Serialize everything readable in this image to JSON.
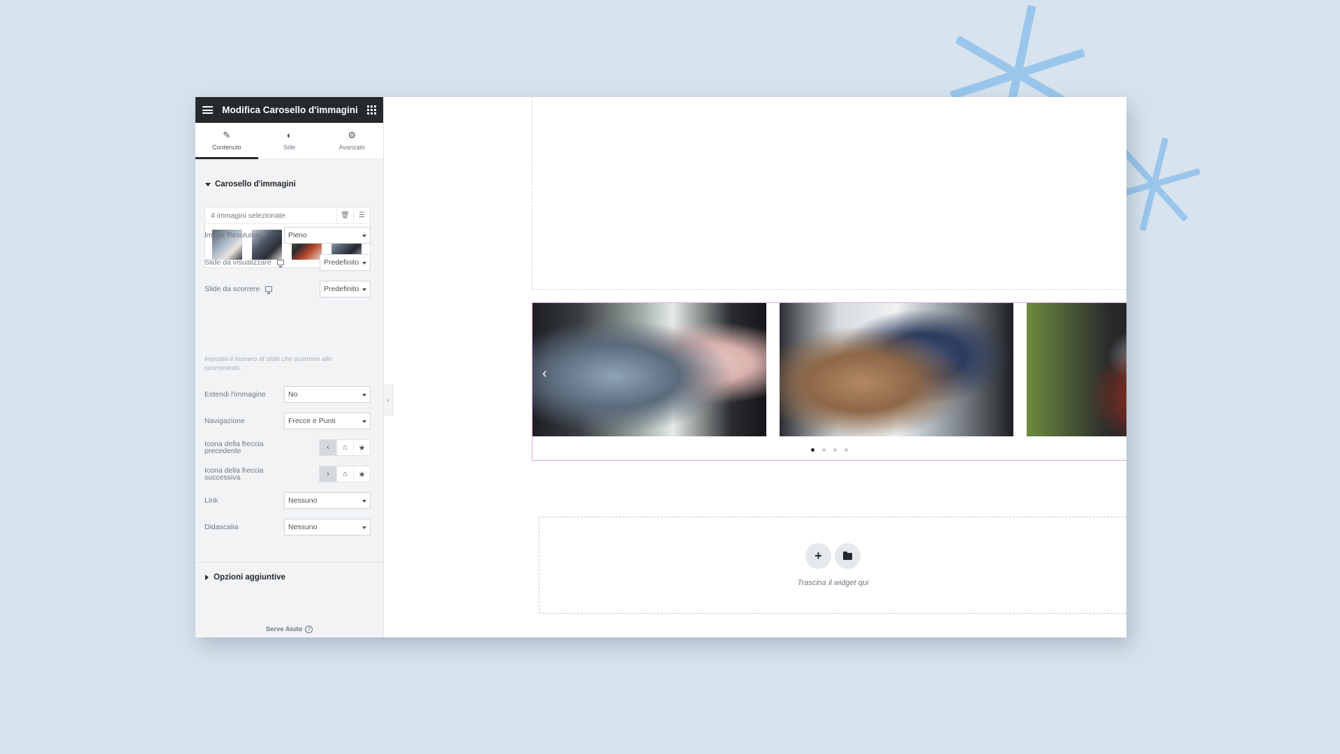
{
  "panel": {
    "title": "Modifica Carosello d'immagini",
    "tabs": [
      {
        "label": "Contenuto",
        "icon": "pencil-icon",
        "glyph": "✎"
      },
      {
        "label": "Stile",
        "icon": "half-circle-icon",
        "glyph": "◐"
      },
      {
        "label": "Avanzato",
        "icon": "gear-icon",
        "glyph": "⚙"
      }
    ],
    "section_title": "Carosello d'immagini",
    "gallery": {
      "count_label": "4 immagini selezionate",
      "delete_glyph": "🗑",
      "edit_glyph": "☰"
    },
    "controls": {
      "image_resolution": {
        "label": "Image Resolution",
        "value": "Pieno"
      },
      "slides_to_show": {
        "label": "Slide da visualizzare",
        "value": "Predefinito"
      },
      "slides_to_scroll": {
        "label": "Slide da scorrere",
        "value": "Predefinito"
      },
      "scroll_help": "Imposta il numero di slide che scorrono allo scorrimento.",
      "stretch_image": {
        "label": "Estendi l'immagine",
        "value": "No"
      },
      "navigation": {
        "label": "Navigazione",
        "value": "Frecce e Punti"
      },
      "prev_arrow_icon": {
        "label_line1": "Icona della freccia",
        "label_line2": "precedente",
        "glyphs": [
          "‹",
          "⌂",
          "★"
        ]
      },
      "next_arrow_icon": {
        "label_line1": "Icona della freccia",
        "label_line2": "successiva",
        "glyphs": [
          "›",
          "⌂",
          "★"
        ]
      },
      "link": {
        "label": "Link",
        "value": "Nessuno"
      },
      "caption": {
        "label": "Didascalia",
        "value": "Nessuno"
      }
    },
    "extra_options": "Opzioni aggiuntive",
    "help": "Serve Aiuto",
    "help_glyph": "?",
    "collapse_glyph": "‹"
  },
  "canvas": {
    "carousel": {
      "prev_glyph": "‹",
      "dots_total": 4,
      "active_dot": 0
    },
    "drop_zone": {
      "text": "Trascina il widget qui",
      "add_glyph": "+"
    }
  },
  "colors": {
    "background": "#d7e3ee",
    "accent_deco": "#9ac6ec",
    "panel_header": "#26292c",
    "carousel_border": "#e8a7ec"
  }
}
